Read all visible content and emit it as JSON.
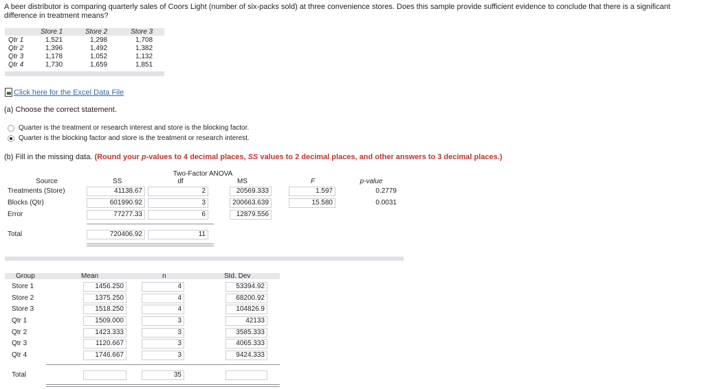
{
  "question": "A beer distributor is comparing quarterly sales of Coors Light (number of six-packs sold) at three convenience stores. Does this sample provide sufficient evidence to conclude that there is a significant difference in treatment means?",
  "sales_table": {
    "columns": [
      "Store 1",
      "Store 2",
      "Store 3"
    ],
    "rows": [
      {
        "label": "Qtr 1",
        "values": [
          "1,521",
          "1,298",
          "1,708"
        ]
      },
      {
        "label": "Qtr 2",
        "values": [
          "1,396",
          "1,492",
          "1,382"
        ]
      },
      {
        "label": "Qtr 3",
        "values": [
          "1,178",
          "1,052",
          "1,132"
        ]
      },
      {
        "label": "Qtr 4",
        "values": [
          "1,730",
          "1,659",
          "1,851"
        ]
      }
    ]
  },
  "excel_link": "Click here for the Excel Data File",
  "part_a": {
    "prompt": "(a) Choose the correct statement.",
    "options": [
      {
        "label": "Quarter is the treatment or research interest and store is the blocking factor.",
        "selected": false
      },
      {
        "label": "Quarter is the blocking factor and store is the treatment or research interest.",
        "selected": true
      }
    ]
  },
  "part_b": {
    "prompt": "(b) Fill in the missing data.",
    "instruction_1": "(Round your ",
    "instruction_pval": "p",
    "instruction_2": "-values to 4 decimal places, ",
    "instruction_ss": "SS",
    "instruction_3": " values to 2 decimal places, and other answers to 3 decimal places.)"
  },
  "anova": {
    "title": "Two-Factor ANOVA",
    "headers": {
      "source": "Source",
      "ss": "SS",
      "df": "df",
      "ms": "MS",
      "f": "F",
      "p": "p-value"
    },
    "rows": [
      {
        "source": "Treatments (Store)",
        "ss": "41138.67",
        "df": "2",
        "ms": "20569.333",
        "f": "1.597",
        "p": "0.2779"
      },
      {
        "source": "Blocks (Qtr)",
        "ss": "601990.92",
        "df": "3",
        "ms": "200663.639",
        "f": "15.580",
        "p": "0.0031"
      },
      {
        "source": "Error",
        "ss": "77277.33",
        "df": "6",
        "ms": "12879.556"
      }
    ],
    "total": {
      "source": "Total",
      "ss": "720406.92",
      "df": "11"
    }
  },
  "groups": {
    "headers": {
      "group": "Group",
      "mean": "Mean",
      "n": "n",
      "sd": "Std. Dev"
    },
    "rows": [
      {
        "group": "Store 1",
        "mean": "1456.250",
        "n": "4",
        "sd": "53394.92"
      },
      {
        "group": "Store 2",
        "mean": "1375.250",
        "n": "4",
        "sd": "68200.92"
      },
      {
        "group": "Store 3",
        "mean": "1518.250",
        "n": "4",
        "sd": "104826.9"
      },
      {
        "group": "Qtr 1",
        "mean": "1509.000",
        "n": "3",
        "sd": "42133"
      },
      {
        "group": "Qtr 2",
        "mean": "1423.333",
        "n": "3",
        "sd": "3585.333"
      },
      {
        "group": "Qtr 3",
        "mean": "1120.667",
        "n": "3",
        "sd": "4065.333"
      },
      {
        "group": "Qtr 4",
        "mean": "1746.667",
        "n": "3",
        "sd": "9424.333"
      }
    ],
    "total": {
      "group": "Total",
      "mean": "",
      "n": "35",
      "sd": ""
    }
  },
  "colors": {
    "link": "#2a6ab0",
    "instruction_red": "#c0312b",
    "header_bar": "#e6e7e9"
  }
}
